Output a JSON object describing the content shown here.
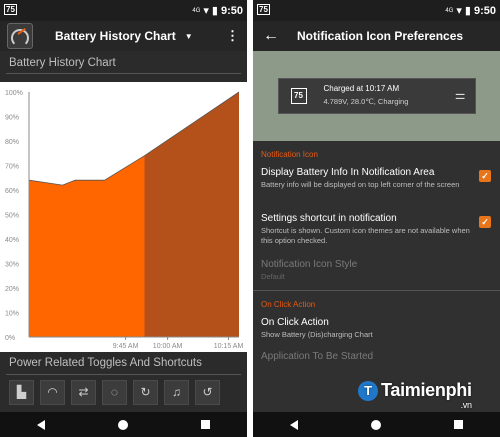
{
  "left": {
    "status": {
      "badge": "75",
      "signal": "4G",
      "time": "9:50"
    },
    "appbar": {
      "title": "Battery History Chart",
      "caret": "▼",
      "menu": "⋮"
    },
    "section_title": "Battery History Chart",
    "shortcuts_title": "Power Related Toggles And Shortcuts",
    "tiles": [
      "▙",
      "◠",
      "⇄",
      "◌",
      "↻",
      "♫",
      "↺"
    ]
  },
  "right": {
    "status": {
      "badge": "75",
      "signal": "4G",
      "time": "9:50"
    },
    "appbar": {
      "back": "←",
      "title": "Notification Icon Preferences"
    },
    "preview": {
      "badge": "75",
      "line1": "Charged at 10:17 AM",
      "line2": "4.789V, 28.0℃, Charging",
      "icon": "tune-icon"
    },
    "section_notification": "Notification Icon",
    "items": [
      {
        "title": "Display Battery Info In Notification Area",
        "summary": "Battery info will be displayed on top left corner of the screen",
        "checked": true
      },
      {
        "title": "Settings shortcut in notification",
        "summary": "Shortcut is shown. Custom icon themes are not available when this option checked.",
        "checked": true
      },
      {
        "title": "Notification Icon Style",
        "summary": "Default",
        "disabled": true
      }
    ],
    "section_click": "On Click Action",
    "click_items": [
      {
        "title": "On Click Action",
        "summary": "Show Battery (Dis)charging Chart"
      },
      {
        "title": "Application To Be Started",
        "summary": ""
      }
    ]
  },
  "watermark": {
    "text": "Taimienphi",
    "suffix": ".vn"
  },
  "chart_data": {
    "type": "area",
    "title": "Battery History Chart",
    "xlabel": "",
    "ylabel": "",
    "y_ticks": [
      "100%",
      "90%",
      "80%",
      "70%",
      "60%",
      "50%",
      "40%",
      "30%",
      "20%",
      "10%",
      "0%"
    ],
    "x_ticks": [
      {
        "label": "9:45 AM",
        "value": 0.46
      },
      {
        "label": "10:00 AM",
        "value": 0.66
      },
      {
        "label": "10:15 AM",
        "value": 0.95
      }
    ],
    "ylim": [
      0,
      100
    ],
    "series": [
      {
        "name": "",
        "color": "#ff6600",
        "points": [
          [
            0.0,
            64
          ],
          [
            0.08,
            63
          ],
          [
            0.16,
            62
          ],
          [
            0.22,
            64
          ],
          [
            0.36,
            64
          ],
          [
            0.55,
            74
          ]
        ]
      },
      {
        "name": "",
        "color": "#b4501a",
        "points": [
          [
            0.55,
            74
          ],
          [
            1.0,
            100
          ]
        ]
      }
    ],
    "grid": false,
    "colors": {
      "background": "#ffffff",
      "axis": "#8a8a8a",
      "label": "#8a8a8a"
    }
  }
}
